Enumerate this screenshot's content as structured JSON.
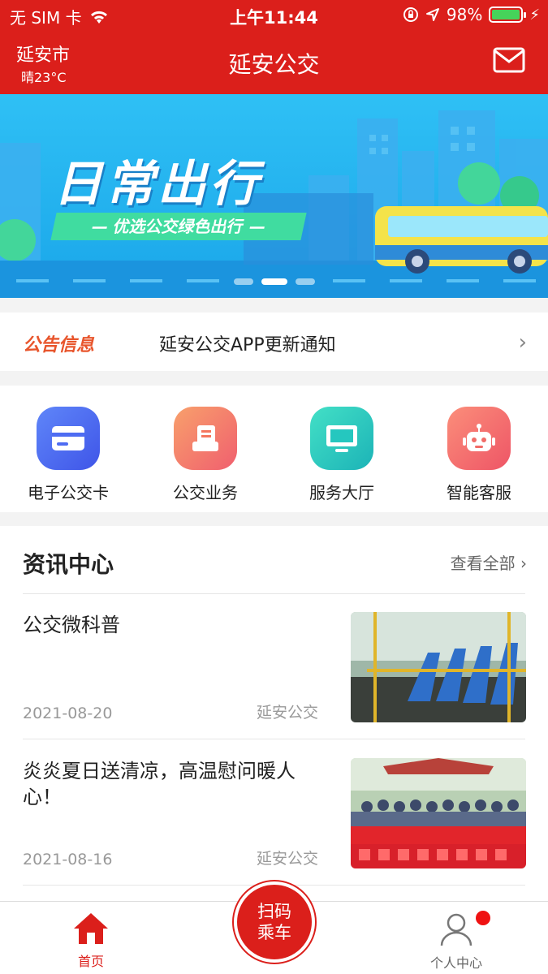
{
  "status_bar": {
    "carrier": "无 SIM 卡",
    "time": "上午11:44",
    "battery": "98%",
    "battery_level": 0.98,
    "battery_color": "#46d35a"
  },
  "header": {
    "city": "延安市",
    "weather": "晴23°C",
    "title": "延安公交",
    "icon": "mail-icon",
    "bg_color": "#db1f1b"
  },
  "banner": {
    "title": "日常出行",
    "subtitle": "— 优选公交绿色出行 —",
    "slides": 3,
    "active_slide": 2
  },
  "notice": {
    "label": "公告信息",
    "text": "延安公交APP更新通知",
    "arrow": "›"
  },
  "quick_menu": [
    {
      "label": "电子公交卡",
      "icon": "card-icon",
      "color": "#4e6cf2"
    },
    {
      "label": "公交业务",
      "icon": "document-icon",
      "color": "#f4775f"
    },
    {
      "label": "服务大厅",
      "icon": "monitor-icon",
      "color": "#25c7bf"
    },
    {
      "label": "智能客服",
      "icon": "robot-icon",
      "color": "#f16c68"
    }
  ],
  "news": {
    "heading": "资讯中心",
    "view_all": "查看全部 ›",
    "articles": [
      {
        "title": "公交微科普",
        "date": "2021-08-20",
        "source": "延安公交"
      },
      {
        "title": "炎炎夏日送清凉，高温慰问暖人心！",
        "date": "2021-08-16",
        "source": "延安公交"
      }
    ]
  },
  "tabbar": {
    "home": "首页",
    "scan_line1": "扫码",
    "scan_line2": "乘车",
    "profile": "个人中心"
  }
}
